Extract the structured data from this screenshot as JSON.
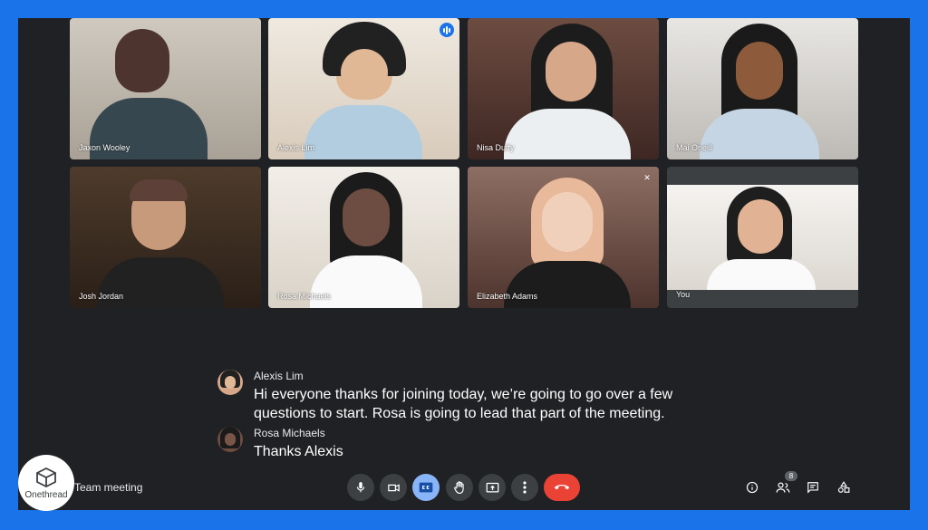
{
  "participants": [
    {
      "name": "Jaxon Wooley"
    },
    {
      "name": "Alexis Lim"
    },
    {
      "name": "Nisa Duffy"
    },
    {
      "name": "Mai Oneill"
    },
    {
      "name": "Josh Jordan"
    },
    {
      "name": "Rosa Michaels"
    },
    {
      "name": "Elizabeth Adams"
    },
    {
      "name": "You"
    }
  ],
  "captions": [
    {
      "speaker": "Alexis Lim",
      "text": "Hi everyone thanks for joining today, we’re going to go over a few questions to start. Rosa is going to lead that part of the meeting."
    },
    {
      "speaker": "Rosa Michaels",
      "text": "Thanks Alexis"
    }
  ],
  "meeting": {
    "title": "Team meeting"
  },
  "people_count": "8",
  "logo": {
    "text": "Onethread"
  },
  "colors": {
    "frame": "#1a73e8",
    "background": "#202124",
    "end_call": "#ea4335",
    "captions_active": "#8ab4f8"
  }
}
